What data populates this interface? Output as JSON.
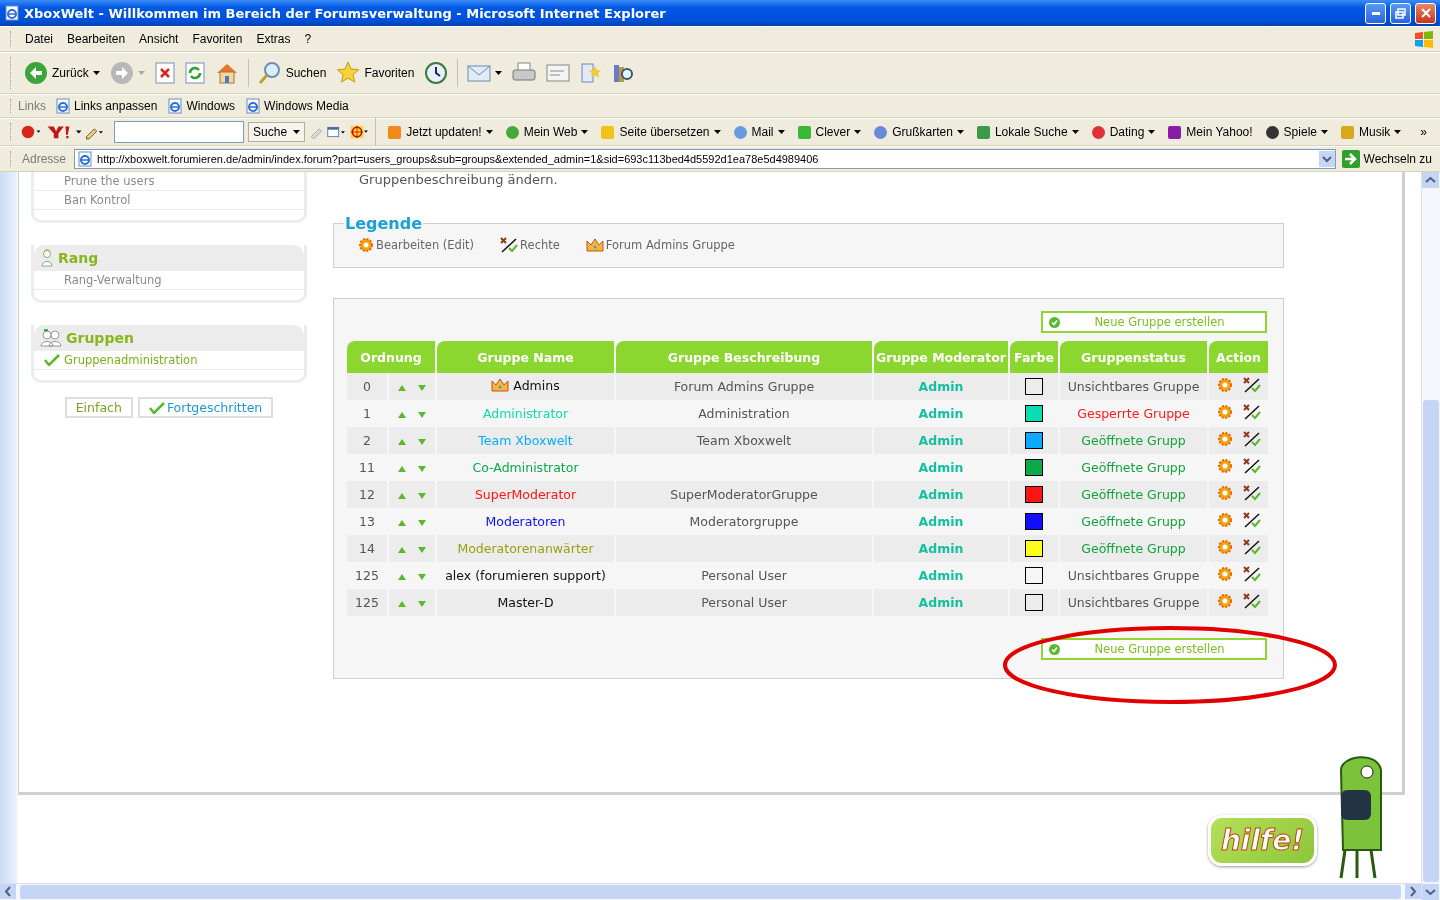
{
  "window": {
    "title": "XboxWelt - Willkommen im Bereich der Forumsverwaltung - Microsoft Internet Explorer"
  },
  "menu": [
    "Datei",
    "Bearbeiten",
    "Ansicht",
    "Favoriten",
    "Extras",
    "?"
  ],
  "toolbar": [
    {
      "kind": "back",
      "label": "Zurück",
      "dropdown": true
    },
    {
      "kind": "forward",
      "dropdown": true
    },
    {
      "kind": "stop"
    },
    {
      "kind": "refresh"
    },
    {
      "kind": "home"
    },
    {
      "kind": "search",
      "label": "Suchen"
    },
    {
      "kind": "favorites",
      "label": "Favoriten"
    },
    {
      "kind": "history"
    },
    {
      "kind": "mail",
      "dropdown": true
    },
    {
      "kind": "print"
    },
    {
      "kind": "edit"
    },
    {
      "kind": "messenger"
    },
    {
      "kind": "research"
    }
  ],
  "links": {
    "label": "Links",
    "items": [
      "Links anpassen",
      "Windows",
      "Windows Media"
    ]
  },
  "yahoo_bar": {
    "search_button": "Suche",
    "items": [
      {
        "label": "Jetzt updaten!",
        "dropdown": true
      },
      {
        "label": "Mein Web",
        "dropdown": true
      },
      {
        "label": "Seite übersetzen",
        "dropdown": true
      },
      {
        "label": "Mail",
        "dropdown": true
      },
      {
        "label": "Clever",
        "dropdown": true
      },
      {
        "label": "Grußkarten",
        "dropdown": true
      },
      {
        "label": "Lokale Suche",
        "dropdown": true
      },
      {
        "label": "Dating",
        "dropdown": true
      },
      {
        "label": "Mein Yahoo!",
        "dropdown": false
      },
      {
        "label": "Spiele",
        "dropdown": true
      },
      {
        "label": "Musik",
        "dropdown": true
      }
    ],
    "more": "»"
  },
  "address": {
    "label": "Adresse",
    "url": "http://xboxwelt.forumieren.de/admin/index.forum?part=users_groups&sub=groups&extended_admin=1&sid=693c113bed4d5592d1ea78e5d4989406",
    "go": "Wechseln zu"
  },
  "sidebar": {
    "sections": [
      {
        "kind": "users",
        "items": [
          {
            "label": "Prune the users",
            "selected": false
          },
          {
            "label": "Ban Kontrol",
            "selected": false
          }
        ]
      },
      {
        "kind": "rank",
        "title": "Rang",
        "items": [
          {
            "label": "Rang-Verwaltung",
            "selected": false
          }
        ]
      },
      {
        "kind": "groups",
        "title": "Gruppen",
        "items": [
          {
            "label": "Gruppenadministration",
            "selected": true
          }
        ]
      }
    ],
    "view_buttons": [
      {
        "label": "Einfach",
        "selected": false
      },
      {
        "label": "Fortgeschritten",
        "selected": true
      }
    ]
  },
  "intro_text": "Gruppenbeschreibung ändern.",
  "legend": {
    "title": "Legende",
    "items": [
      {
        "kind": "edit",
        "label": "Bearbeiten (Edit)"
      },
      {
        "kind": "rights",
        "label": "Rechte"
      },
      {
        "kind": "admins",
        "label": "Forum Admins Gruppe"
      }
    ]
  },
  "create_buttons": [
    "Neue Gruppe erstellen",
    "Neue Gruppe erstellen"
  ],
  "table": {
    "columns": [
      "Ordnung",
      "Gruppe Name",
      "Gruppe Beschreibung",
      "Gruppe Moderator",
      "Farbe",
      "Gruppenstatus",
      "Action"
    ],
    "rows": [
      {
        "order": "0",
        "name": "Admins",
        "crown": true,
        "description": "Forum Admins Gruppe",
        "moderator": "Admin",
        "status": {
          "kind": "invisible",
          "label": "Unsichtbares Gruppe"
        }
      },
      {
        "order": "1",
        "name": "Administrator",
        "color": "#0adcb4",
        "description": "Administration",
        "moderator": "Admin",
        "status": {
          "kind": "closed",
          "label": "Gesperrte Gruppe"
        }
      },
      {
        "order": "2",
        "name": "Team Xboxwelt",
        "color": "#0aaaff",
        "description": "Team Xboxwelt",
        "moderator": "Admin",
        "status": {
          "kind": "open",
          "label": "Geöffnete Grupp"
        }
      },
      {
        "order": "11",
        "name": "Co-Administrator",
        "color": "#0aaa4a",
        "description": "",
        "moderator": "Admin",
        "status": {
          "kind": "open",
          "label": "Geöffnete Grupp"
        }
      },
      {
        "order": "12",
        "name": "SuperModerator",
        "color": "#ff1414",
        "description": "SuperModeratorGruppe",
        "moderator": "Admin",
        "status": {
          "kind": "open",
          "label": "Geöffnete Grupp"
        }
      },
      {
        "order": "13",
        "name": "Moderatoren",
        "color": "#1010ff",
        "description": "Moderatorgruppe",
        "moderator": "Admin",
        "status": {
          "kind": "open",
          "label": "Geöffnete Grupp"
        }
      },
      {
        "order": "14",
        "name": "Moderatorenanwärter",
        "color": "#ffff1e",
        "description": "",
        "moderator": "Admin",
        "status": {
          "kind": "open",
          "label": "Geöffnete Grupp"
        }
      },
      {
        "order": "125",
        "name": "alex (forumieren support)",
        "description": "Personal User",
        "moderator": "Admin",
        "status": {
          "kind": "invisible",
          "label": "Unsichtbares Gruppe"
        }
      },
      {
        "order": "125",
        "name": "Master-D",
        "description": "Personal User",
        "moderator": "Admin",
        "status": {
          "kind": "invisible",
          "label": "Unsichtbares Gruppe"
        }
      }
    ]
  },
  "help_widget": {
    "label": "hilfe!"
  }
}
